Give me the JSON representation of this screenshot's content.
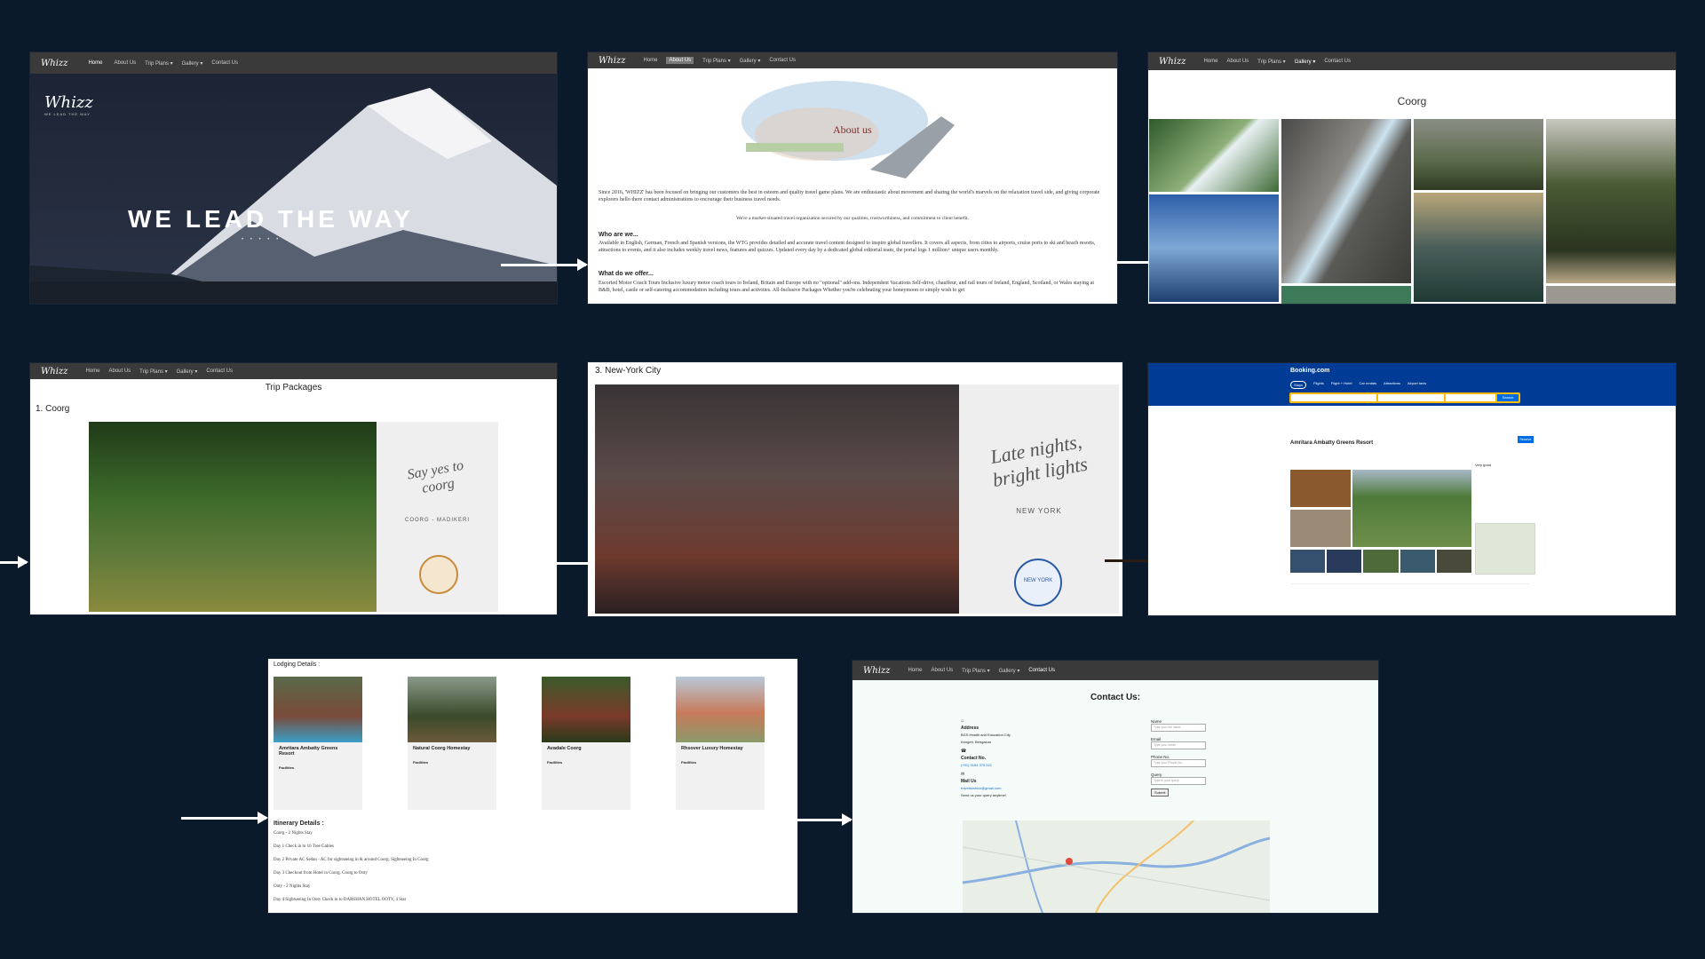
{
  "nav": {
    "logo": "Whizz",
    "items": [
      "Home",
      "About Us",
      "Trip Plans ▾",
      "Gallery ▾",
      "Contact Us"
    ]
  },
  "hero": {
    "logo": "Whizz",
    "logo_sub": "WE LEAD THE WAY",
    "headline": "WE LEAD THE WAY"
  },
  "about": {
    "title": "About us",
    "intro": "Since 2016, 'WHIZZ' has been focused on bringing our customers the best in esteem and quality travel game plans. We are enthusiastic about movement and sharing the world's marvels on the relaxation travel side, and giving corporate explorers hello there contact administrations to encourage their business travel needs.",
    "center_line": "We're a market-situated travel organization secured by our qualities, trustworthiness, and commitment to client benefit.",
    "who_heading": "Who are we...",
    "who_text": "Available in English, German, French and Spanish versions, the WTG provides detailed and accurate travel content designed to inspire global travellers. It covers all aspects, from cities to airports, cruise ports to ski and beach resorts, attractions to events, and it also includes weekly travel news, features and quizzes. Updated every day by a dedicated global editorial team, the portal logs 1 million+ unique users monthly.",
    "what_heading": "What do we offer...",
    "what_text": "Escorted Motor Coach Tours Inclusive luxury motor coach tours to Ireland, Britain and Europe with no \"optional\" add-ons. Independent Vacations Self-drive, chauffeur, and rail tours of Ireland, England, Scotland, or Wales staying at B&B, hotel, castle or self-catering accommodation including tours and activities. All-Inclusive Packages Whether you're celebrating your honeymoon or simply wish to get"
  },
  "gallery": {
    "title": "Coorg"
  },
  "packages": {
    "title": "Trip Packages",
    "section": "1. Coorg",
    "card_script": "Say yes to coorg",
    "card_sub": "COORG - MADIKERI"
  },
  "nyc": {
    "section": "3. New-York City",
    "card_script": "Late nights, bright lights",
    "card_sub": "NEW YORK",
    "stamp": "NEW YORK"
  },
  "booking": {
    "brand": "Booking.com",
    "hotel_name": "Amritara Ambatty Greens Resort",
    "search_button": "Search",
    "tabs": [
      "Stays",
      "Flights",
      "Flight + Hotel",
      "Car rentals",
      "Attractions",
      "Airport taxis"
    ],
    "rating": "Very good",
    "reserve": "Reserve"
  },
  "lodging": {
    "title": "Lodging Details :",
    "cards": [
      {
        "name": "Amritara Ambatty Greens Resort",
        "facilities": "Facilities"
      },
      {
        "name": "Natural Coorg Homestay",
        "facilities": "Facilities"
      },
      {
        "name": "Avadale Coorg",
        "facilities": "Facilities"
      },
      {
        "name": "Rhsover Luxury Homestay",
        "facilities": "Facilities"
      }
    ],
    "itinerary_title": "Itinerary Details :",
    "itinerary": [
      "Coorg - 2 Nights Stay",
      "Day 1 Check in to 16 Tree Gables",
      "Day 2 Private AC Sedan - AC for sightseeing in & around Coorg. Sightseeing In Coorg",
      "Day 3 Checkout from Hotel in Coorg. Coorg to Ooty",
      "Ooty - 2 Nights Stay",
      "Day 4 Sightseeing In Ooty Check in to DARSHAN HOTEL OOTY, 4 Star"
    ]
  },
  "contact": {
    "title": "Contact Us:",
    "address_label": "Address",
    "address_lines": [
      "BGS Health and Education City",
      "Kengeri, Bengaluru"
    ],
    "phone_label": "Contact No.",
    "phone": "(+91) 9164 375 521",
    "mail_label": "Mail Us",
    "mail": "traveltowhizz@gmail.com",
    "mail_note": "Send us your query anytime!",
    "fields": [
      {
        "label": "Name",
        "placeholder": "Type your full name"
      },
      {
        "label": "Email",
        "placeholder": "Type your email"
      },
      {
        "label": "Phone No.",
        "placeholder": "Type your Phone No."
      },
      {
        "label": "Query",
        "placeholder": "Type in your query"
      }
    ],
    "submit": "Submit"
  },
  "colors": {
    "background": "#0b1a2b",
    "nav": "#3a3a3a",
    "booking_blue": "#003b95",
    "panel": "#ffffff"
  }
}
